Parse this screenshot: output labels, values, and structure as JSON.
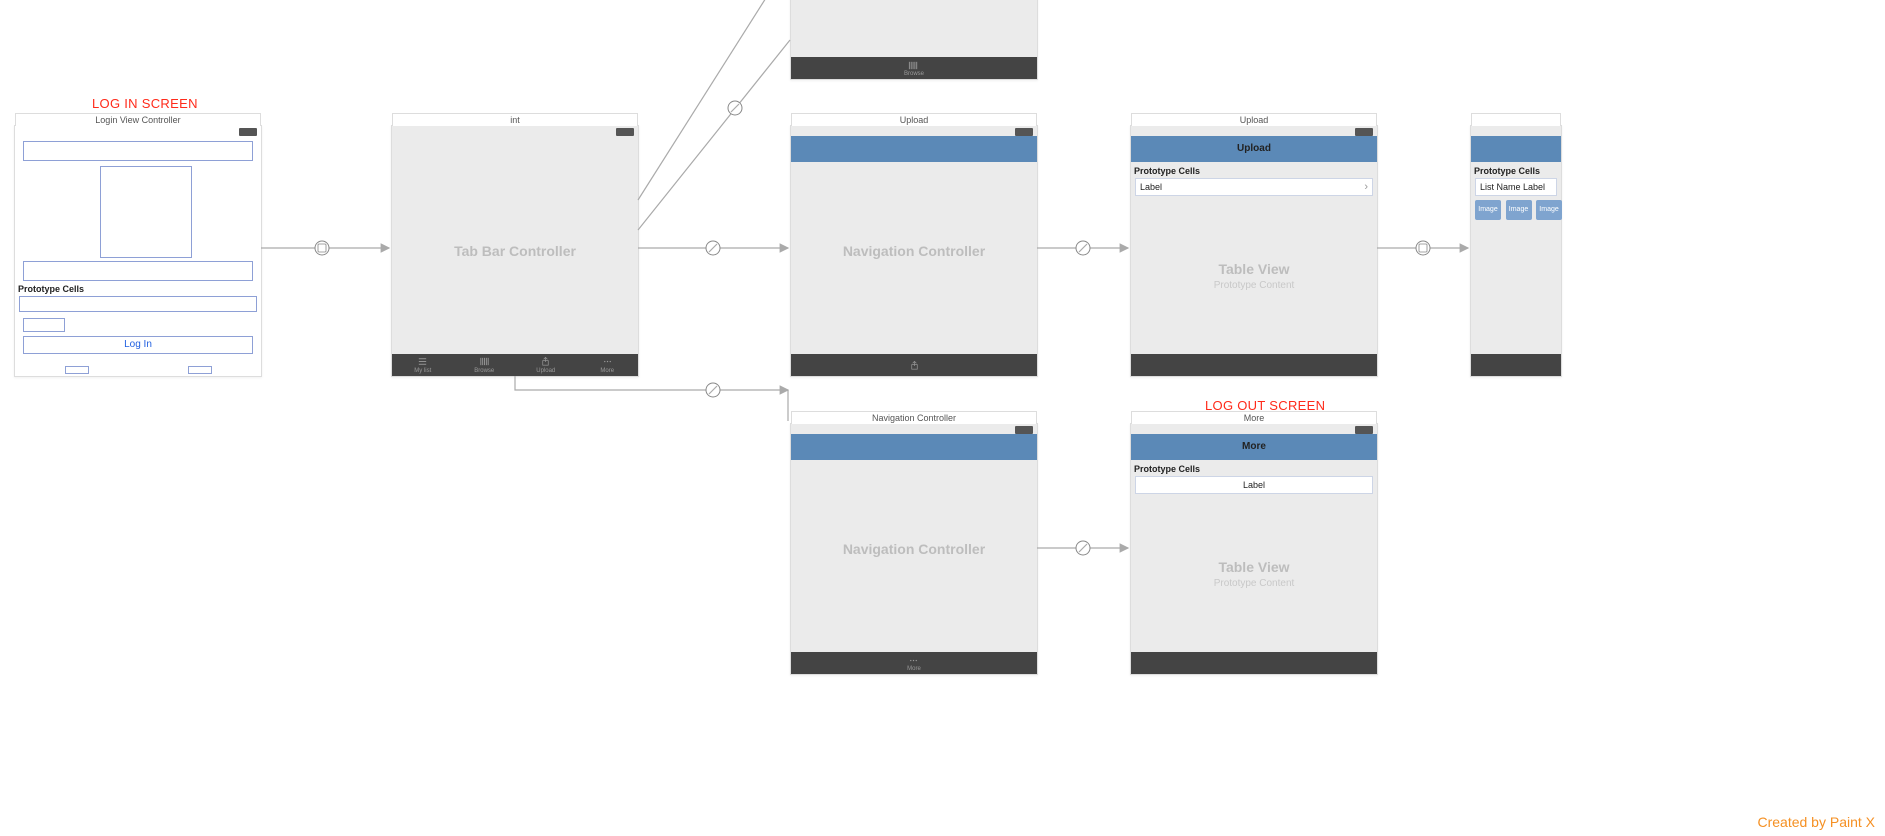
{
  "annotations": {
    "login": "LOG IN SCREEN",
    "logout": "LOG OUT SCREEN"
  },
  "watermark": "Created by Paint X",
  "scenes": {
    "login": {
      "title": "Login View Controller",
      "buttonLabel": "Log In",
      "protoHeader": "Prototype Cells"
    },
    "tabbar": {
      "title": "int",
      "centerLabel": "Tab Bar Controller",
      "tabs": [
        "My list",
        "Browse",
        "Upload",
        "More"
      ]
    },
    "topPartial": {
      "tabLabel": "Browse"
    },
    "nav1": {
      "title": "Upload",
      "centerLabel": "Navigation Controller"
    },
    "table1": {
      "title": "Upload",
      "navTitle": "Upload",
      "protoHeader": "Prototype Cells",
      "cellLabel": "Label",
      "centerLabel": "Table View",
      "subLabel": "Prototype Content"
    },
    "nav2": {
      "title": "Navigation Controller",
      "centerLabel": "Navigation Controller",
      "tabLabel": "More"
    },
    "table2": {
      "title": "More",
      "navTitle": "More",
      "protoHeader": "Prototype Cells",
      "cellLabel": "Label",
      "centerLabel": "Table View",
      "subLabel": "Prototype Content"
    },
    "partialRight": {
      "protoHeader": "Prototype Cells",
      "cellLabel": "List Name Label",
      "imagePill": "Image"
    }
  }
}
